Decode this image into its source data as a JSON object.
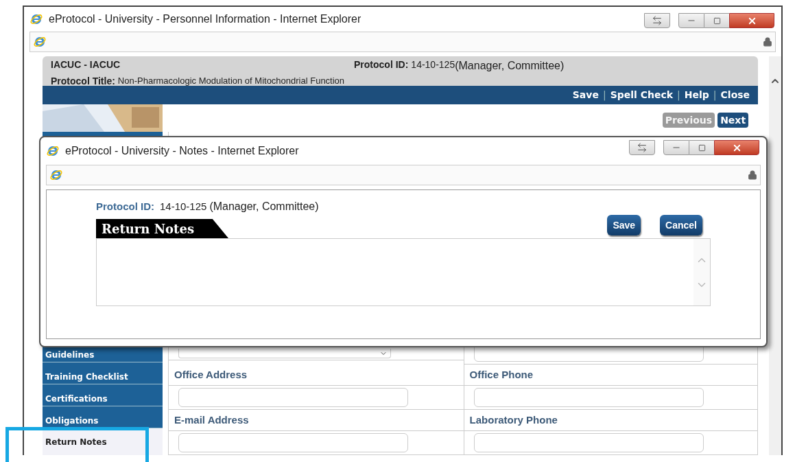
{
  "main_window": {
    "title": "eProtocol - University - Personnel Information - Internet Explorer",
    "header": {
      "committee": "IACUC - IACUC",
      "protocol_id_label": "Protocol ID:",
      "protocol_id": "14-10-125",
      "roles": "(Manager, Committee)",
      "title_label": "Protocol Title:",
      "title": "Non-Pharmacologic Modulation of Mitochondrial Function"
    },
    "toolbar_links": [
      "Save",
      "Spell Check",
      "Help",
      "Close"
    ],
    "link_separator": "|",
    "nav_buttons": [
      {
        "label": "Previous",
        "disabled": true
      },
      {
        "label": "Next",
        "disabled": false
      }
    ],
    "sidebar": {
      "items": [
        {
          "label": "Guidelines",
          "selected": false
        },
        {
          "label": "Training Checklist",
          "selected": false
        },
        {
          "label": "Certifications",
          "selected": false
        },
        {
          "label": "Obligations",
          "selected": false
        },
        {
          "label": "Return Notes",
          "selected": true
        }
      ]
    },
    "form": {
      "rows": [
        [
          {
            "kind": "select"
          },
          {
            "kind": "input"
          }
        ],
        [
          {
            "kind": "label",
            "text": "Office Address"
          },
          {
            "kind": "label",
            "text": "Office Phone"
          }
        ],
        [
          {
            "kind": "input"
          },
          {
            "kind": "input"
          }
        ],
        [
          {
            "kind": "label",
            "text": "E-mail Address"
          },
          {
            "kind": "label",
            "text": "Laboratory Phone"
          }
        ],
        [
          {
            "kind": "input"
          },
          {
            "kind": "input"
          }
        ]
      ]
    }
  },
  "notes_window": {
    "title": "eProtocol - University - Notes - Internet Explorer",
    "protocol_id_label": "Protocol ID:",
    "protocol_id": "14-10-125",
    "roles": "(Manager, Committee)",
    "section_title": "Return Notes",
    "buttons": [
      "Save",
      "Cancel"
    ]
  }
}
